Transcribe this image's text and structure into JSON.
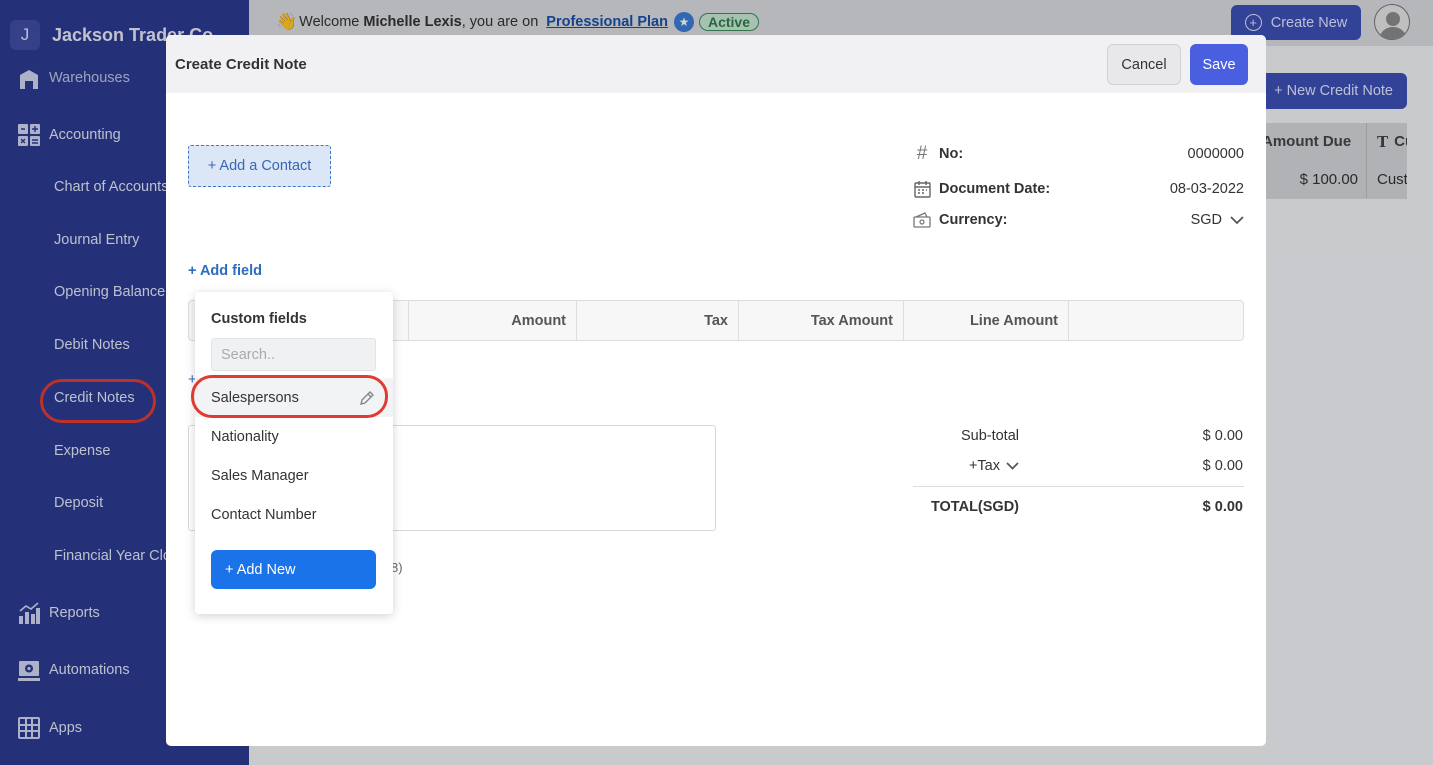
{
  "company": {
    "initial": "J",
    "name": "Jackson Trader Co"
  },
  "sidebar": {
    "warehouses": "Warehouses",
    "accounting": "Accounting",
    "sub_items": [
      "Chart of Accounts",
      "Journal Entry",
      "Opening Balance",
      "Debit Notes",
      "Credit Notes",
      "Expense",
      "Deposit",
      "Financial Year Close"
    ],
    "reports": "Reports",
    "automations": "Automations",
    "apps": "Apps"
  },
  "topbar": {
    "welcome_prefix": "Welcome ",
    "user_name": "Michelle Lexis",
    "welcome_suffix": ", you are on",
    "plan_link": "Professional Plan",
    "plan_status": "Active",
    "create_new": "Create New"
  },
  "background_page": {
    "new_credit_note": "+ New Credit Note",
    "col_amount_due": "Amount Due",
    "col_customer": "Customer",
    "row_amount": "$ 100.00",
    "row_customer": "Customer"
  },
  "modal": {
    "title": "Create Credit Note",
    "cancel": "Cancel",
    "save": "Save",
    "add_contact": "+ Add a Contact",
    "no_label": "No:",
    "no_value": "0000000",
    "date_label": "Document Date:",
    "date_value": "08-03-2022",
    "currency_label": "Currency:",
    "currency_value": "SGD",
    "add_field": "+ Add field",
    "table_headers": [
      "Amount",
      "Tax",
      "Tax Amount",
      "Line Amount"
    ],
    "add_line": "+",
    "faint_text": "8)",
    "totals": {
      "subtotal_label": "Sub-total",
      "subtotal_value": "$ 0.00",
      "tax_label": "+Tax",
      "tax_value": "$ 0.00",
      "total_label": "TOTAL(SGD)",
      "total_value": "$ 0.00"
    }
  },
  "custom_fields_popup": {
    "title": "Custom fields",
    "search_placeholder": "Search..",
    "items": [
      "Salespersons",
      "Nationality",
      "Sales Manager",
      "Contact Number"
    ],
    "add_new": "+ Add New"
  },
  "colors": {
    "sidebar_bg": "#2b3a8f",
    "primary": "#4a5fe0",
    "link": "#2e6cc0",
    "active_badge": "#2e7d4f",
    "highlight_ring": "#e03b33"
  }
}
